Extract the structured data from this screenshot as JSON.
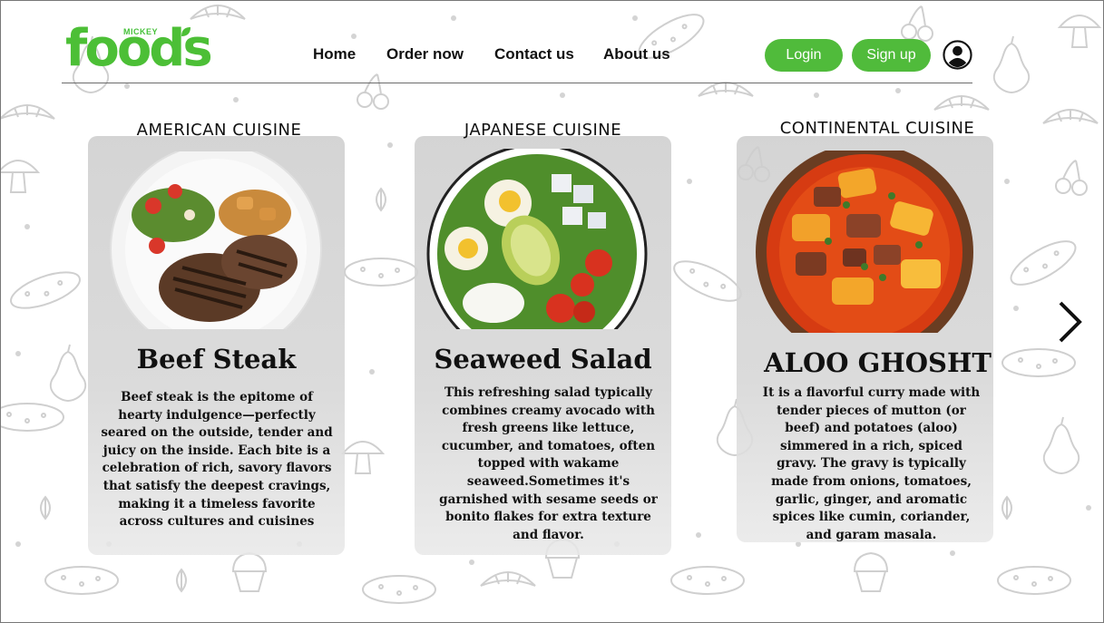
{
  "logo": {
    "small": "MICKEY",
    "word": "foods"
  },
  "nav": [
    {
      "label": "Home"
    },
    {
      "label": "Order now"
    },
    {
      "label": "Contact us"
    },
    {
      "label": "About us"
    }
  ],
  "auth": {
    "login": "Login",
    "signup": "Sign up"
  },
  "colors": {
    "accent": "#50bb3b",
    "brand_green": "#4cbf36"
  },
  "cards": [
    {
      "cuisine": "AMERICAN CUISINE",
      "title": "Beef Steak",
      "description": "Beef steak is the epitome of hearty indulgence—perfectly seared on the outside, tender and juicy on the inside. Each bite is a celebration of rich, savory flavors that satisfy the deepest cravings, making it a timeless favorite across cultures and cuisines"
    },
    {
      "cuisine": "JAPANESE CUISINE",
      "title": "Seaweed Salad",
      "description": "This refreshing salad typically combines creamy avocado with fresh greens like lettuce, cucumber, and tomatoes, often topped with wakame seaweed.Sometimes it's garnished with sesame seeds or bonito flakes for extra texture and flavor."
    },
    {
      "cuisine": "CONTINENTAL CUISINE",
      "title": "ALOO GHOSHT",
      "description": "It is a flavorful curry made with tender pieces of mutton (or beef) and potatoes (aloo) simmered in a rich, spiced gravy. The gravy is typically made from onions, tomatoes, garlic, ginger, and aromatic spices like cumin, coriander, and garam masala."
    }
  ],
  "icons": {
    "user": "user-circle-icon",
    "next": "chevron-right-icon"
  }
}
